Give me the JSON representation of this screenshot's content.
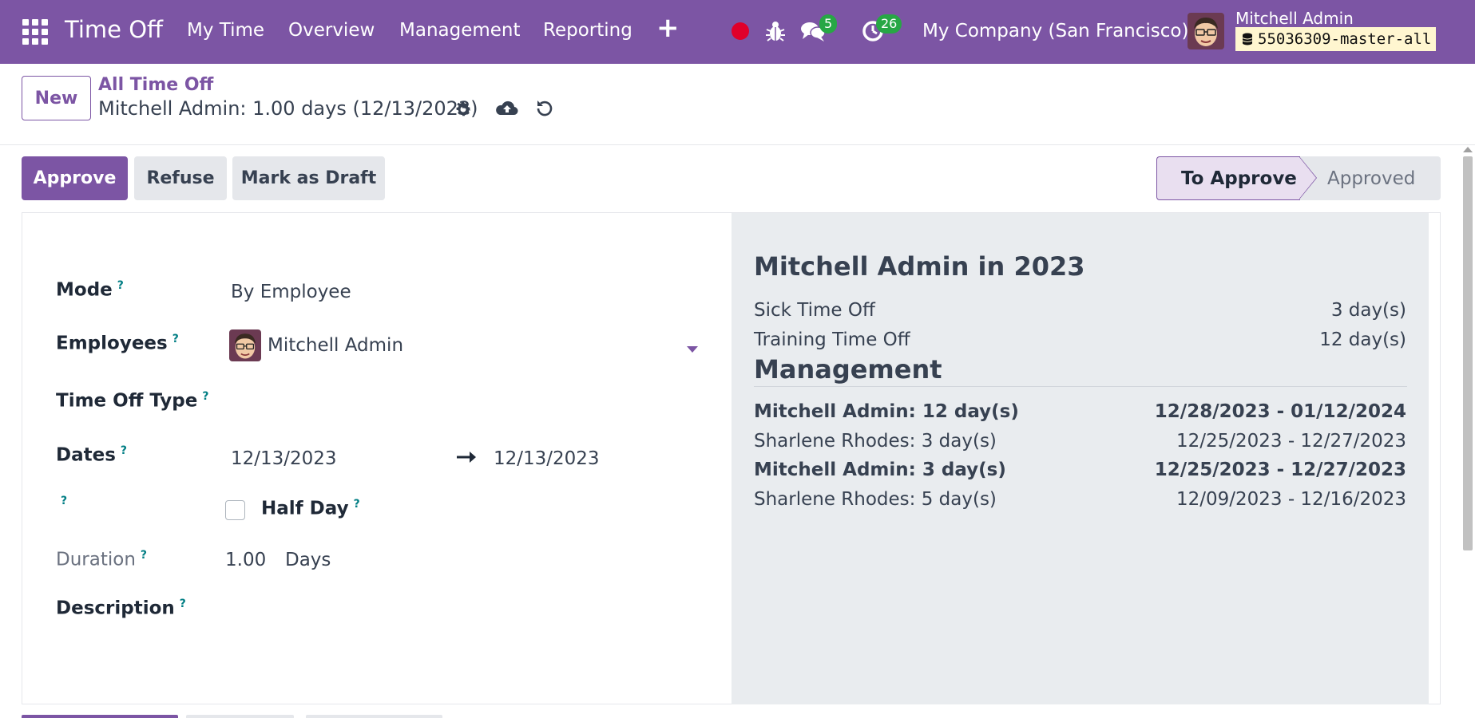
{
  "navbar": {
    "app_title": "Time Off",
    "menu": [
      "My Time",
      "Overview",
      "Management",
      "Reporting"
    ],
    "chat_count": "5",
    "activity_count": "26",
    "company": "My Company (San Francisco)",
    "user_name": "Mitchell Admin",
    "db_name": "55036309-master-all"
  },
  "control": {
    "new_label": "New",
    "breadcrumb": "All Time Off",
    "record_title": "Mitchell Admin: 1.00 days (12/13/2023)"
  },
  "actions": {
    "approve": "Approve",
    "refuse": "Refuse",
    "draft": "Mark as Draft"
  },
  "status": {
    "current": "To Approve",
    "next": "Approved"
  },
  "form": {
    "mode_label": "Mode",
    "mode_value": "By Employee",
    "employees_label": "Employees",
    "employee_value": "Mitchell Admin",
    "type_label": "Time Off Type",
    "dates_label": "Dates",
    "date_from": "12/13/2023",
    "date_to": "12/13/2023",
    "half_day_label": "Half Day",
    "duration_label": "Duration",
    "duration_value": "1.00",
    "duration_unit": "Days",
    "description_label": "Description",
    "help": "?"
  },
  "summary": {
    "title": "Mitchell Admin in 2023",
    "allocations": [
      {
        "name": "Sick Time Off",
        "value": "3 day(s)"
      },
      {
        "name": "Training Time Off",
        "value": "12 day(s)"
      }
    ],
    "management_heading": "Management",
    "management": [
      {
        "name": "Mitchell Admin: 12 day(s)",
        "range": "12/28/2023 - 01/12/2024",
        "bold": true
      },
      {
        "name": "Sharlene Rhodes: 3 day(s)",
        "range": "12/25/2023 - 12/27/2023",
        "bold": false
      },
      {
        "name": "Mitchell Admin: 3 day(s)",
        "range": "12/25/2023 - 12/27/2023",
        "bold": true
      },
      {
        "name": "Sharlene Rhodes: 5 day(s)",
        "range": "12/09/2023 - 12/16/2023",
        "bold": false
      }
    ]
  },
  "colors": {
    "brand": "#7c55a4",
    "badge_green": "#27a745",
    "record_red": "#e0002a",
    "help_teal": "#017e84"
  }
}
